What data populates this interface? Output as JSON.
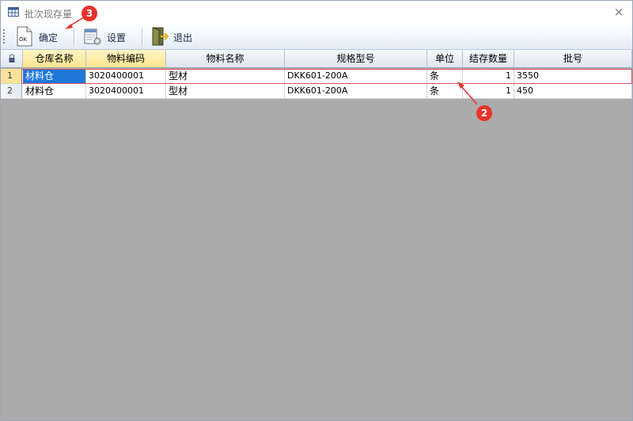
{
  "window": {
    "title": "批次现存量",
    "close_label": "×"
  },
  "toolbar": {
    "ok_label": "确定",
    "settings_label": "设置",
    "exit_label": "退出"
  },
  "table": {
    "columns": [
      "仓库名称",
      "物料编码",
      "物料名称",
      "规格型号",
      "单位",
      "结存数量",
      "批号"
    ],
    "rows": [
      {
        "index": "1",
        "warehouse": "材料仓",
        "code": "3020400001",
        "name": "型材",
        "spec": "DKK601-200A",
        "unit": "条",
        "qty": "1",
        "batch": "3550"
      },
      {
        "index": "2",
        "warehouse": "材料仓",
        "code": "3020400001",
        "name": "型材",
        "spec": "DKK601-200A",
        "unit": "条",
        "qty": "1",
        "batch": "450"
      }
    ]
  },
  "annotations": {
    "badge_2": "2",
    "badge_3": "3"
  },
  "colors": {
    "accent": "#e8322b",
    "selection": "#1e78d8",
    "header_highlight": "#fde58f"
  }
}
